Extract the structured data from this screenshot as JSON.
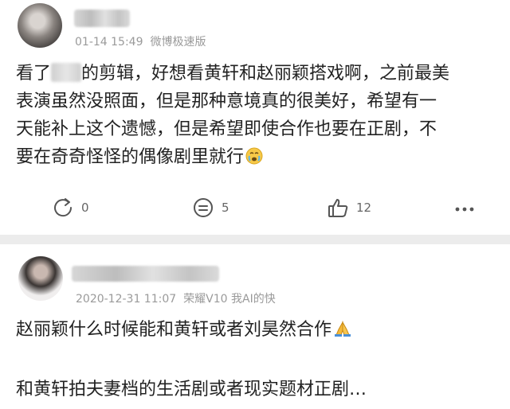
{
  "comments": [
    {
      "time": "01-14 15:49",
      "source": "微博极速版",
      "lines": [
        {
          "before": "看了",
          "after": "的剪辑，好想看黄轩和赵丽颖搭戏啊，之前最美"
        },
        "表演虽然没照面，但是那种意境真的很美好，希望有一",
        "天能补上这个遗憾，但是希望即使合作也要在正剧，不",
        "要在奇奇怪怪的偶像剧里就行"
      ],
      "actions": {
        "repost": "0",
        "comment": "5",
        "like": "12"
      }
    },
    {
      "time": "2020-12-31 11:07",
      "source": "荣耀V10 我AI的快",
      "lines": [
        "赵丽颖什么时候能和黄轩或者刘昊然合作",
        "和黄轩拍夫妻档的生活剧或者现实题材正剧…"
      ]
    }
  ],
  "icons": {
    "repost": "repost-icon",
    "comment": "comment-icon",
    "like": "thumbs-up-icon",
    "more": "more-dots-icon",
    "emoji1": "crying-face-emoji",
    "emoji2": "folded-hands-emoji"
  },
  "colors": {
    "card_bg": "#ffffff",
    "divider_bg": "#ececec",
    "meta_text": "#9a9a9a",
    "icon": "#555555"
  }
}
